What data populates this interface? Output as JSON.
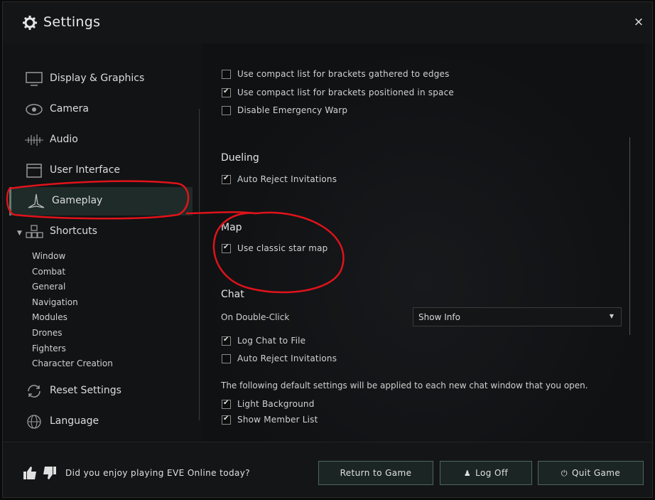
{
  "window": {
    "title": "Settings",
    "close_glyph": "×"
  },
  "sidebar": {
    "items": [
      {
        "label": "Display & Graphics",
        "icon": "monitor-icon"
      },
      {
        "label": "Camera",
        "icon": "eye-icon"
      },
      {
        "label": "Audio",
        "icon": "waveform-icon"
      },
      {
        "label": "User Interface",
        "icon": "window-icon"
      },
      {
        "label": "Gameplay",
        "icon": "ship-icon"
      },
      {
        "label": "Shortcuts",
        "icon": "blocks-icon"
      },
      {
        "label": "Reset Settings",
        "icon": "reset-icon"
      },
      {
        "label": "Language",
        "icon": "globe-icon"
      }
    ],
    "active": "Gameplay",
    "shortcuts_sub": [
      "Window",
      "Combat",
      "General",
      "Navigation",
      "Modules",
      "Drones",
      "Fighters",
      "Character Creation"
    ]
  },
  "content": {
    "brackets": [
      {
        "label": "Use compact list for brackets gathered to edges",
        "checked": false
      },
      {
        "label": "Use compact list for brackets positioned in space",
        "checked": true
      },
      {
        "label": "Disable Emergency Warp",
        "checked": false
      }
    ],
    "dueling": {
      "title": "Dueling",
      "options": [
        {
          "label": "Auto Reject Invitations",
          "checked": true
        }
      ]
    },
    "map": {
      "title": "Map",
      "options": [
        {
          "label": "Use classic star map",
          "checked": true
        }
      ]
    },
    "chat": {
      "title": "Chat",
      "double_click_label": "On Double-Click",
      "double_click_value": "Show Info",
      "options": [
        {
          "label": "Log Chat to File",
          "checked": true
        },
        {
          "label": "Auto Reject Invitations",
          "checked": false
        }
      ],
      "defaults_note": "The following default settings will be applied to each new chat window that you open.",
      "default_options": [
        {
          "label": "Light Background",
          "checked": true
        },
        {
          "label": "Show Member List",
          "checked": true
        }
      ]
    }
  },
  "footer": {
    "feedback_question": "Did you enjoy playing EVE Online today?",
    "return_label": "Return to Game",
    "logoff_label": "Log Off",
    "quit_label": "Quit Game"
  },
  "colors": {
    "accent": "#4d6660",
    "annotation": "#e0131a",
    "active_bg": "#1e2b28"
  }
}
